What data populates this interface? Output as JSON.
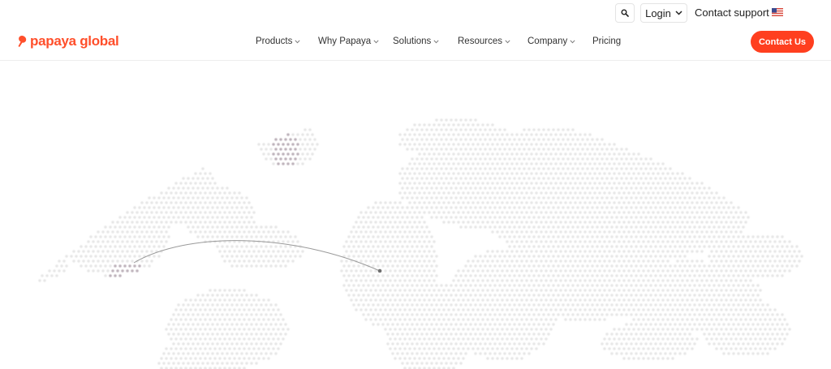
{
  "topbar": {
    "search_icon": "search-icon",
    "login_label": "Login",
    "support_label": "Contact support",
    "flag_icon": "us-flag-icon"
  },
  "brand": {
    "logo_text": "papaya global",
    "accent": "#ff4f2b"
  },
  "nav": {
    "items": [
      {
        "label": "Products",
        "dropdown": true
      },
      {
        "label": "Why Papaya",
        "dropdown": true
      },
      {
        "label": "Solutions",
        "dropdown": true
      },
      {
        "label": "Resources",
        "dropdown": true
      },
      {
        "label": "Company",
        "dropdown": true
      },
      {
        "label": "Pricing",
        "dropdown": false
      }
    ],
    "cta_label": "Contact Us",
    "cta_color": "#ff3f1f"
  },
  "hero": {
    "map_dot_color": "#e6e6e6",
    "highlight_dot_color": "#b9adb6",
    "arc_color": "#9a9a9a"
  }
}
